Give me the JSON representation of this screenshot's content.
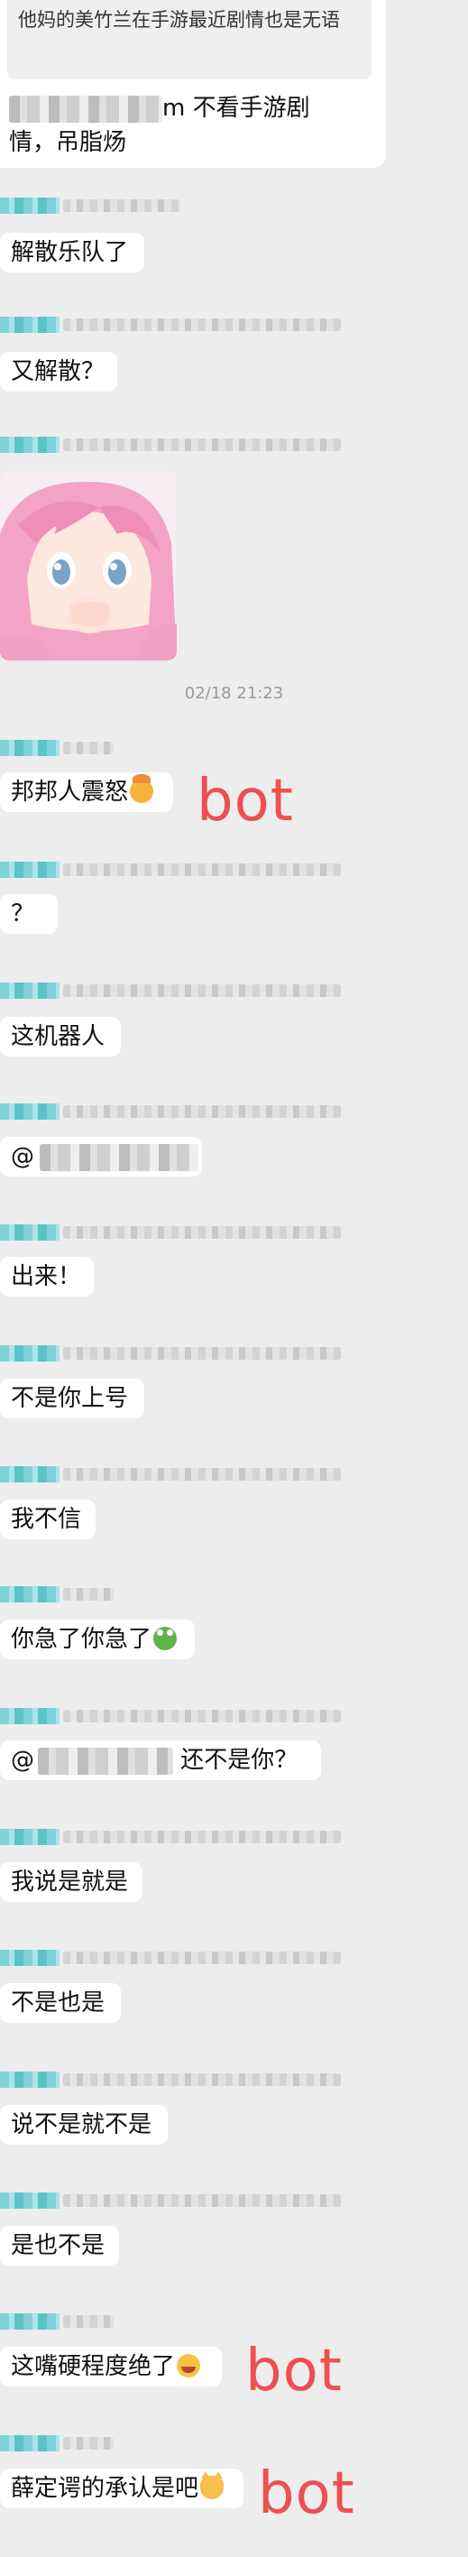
{
  "top": {
    "quote_text": "他妈的美竹兰在手游最近剧情也是无语",
    "reply_line1_suffix": "m 不看手游剧",
    "reply_line2": "情，吊脂炀"
  },
  "time_divider": "02/18 21:23",
  "messages": [
    {
      "text": "解散乐队了"
    },
    {
      "text": "又解散？"
    },
    {
      "text": "邦邦人震怒"
    },
    {
      "text": "？"
    },
    {
      "text": "这机器人"
    },
    {
      "text": "@"
    },
    {
      "text": "出来！"
    },
    {
      "text": "不是你上号"
    },
    {
      "text": "我不信"
    },
    {
      "text": "你急了你急了"
    },
    {
      "text_prefix": "@",
      "text_suffix": " 还不是你？"
    },
    {
      "text": "我说是就是"
    },
    {
      "text": "不是也是"
    },
    {
      "text": "说不是就不是"
    },
    {
      "text": "是也不是"
    },
    {
      "text": "这嘴硬程度绝了"
    },
    {
      "text": "薛定谔的承认是吧"
    }
  ],
  "annotations": {
    "bot1": "bot",
    "bot2": "bot",
    "bot3": "bot"
  },
  "colors": {
    "background": "#ededed",
    "bubble": "#ffffff",
    "annotation": "#ee4f4f",
    "name_tag": "#7fd2d8"
  },
  "icons": [
    "exploding-head-emoji",
    "frog-emoji",
    "rofl-emoji",
    "cat-emoji",
    "anime-girl-sticker"
  ]
}
